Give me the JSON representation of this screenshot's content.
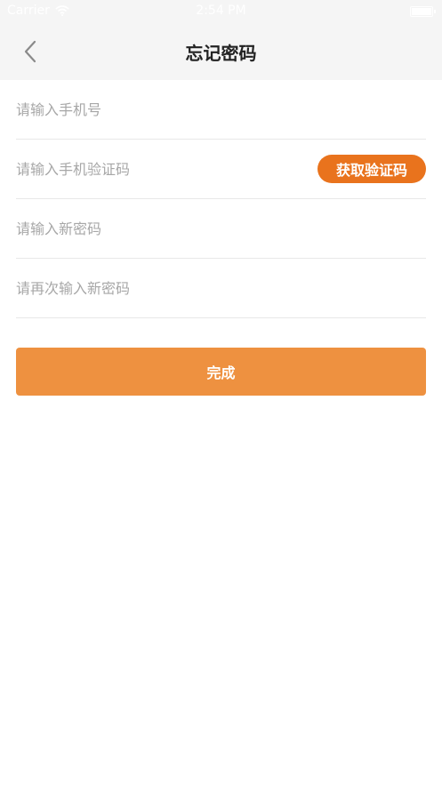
{
  "status_bar": {
    "carrier": "Carrier",
    "wifi_icon": "wifi-icon",
    "time": "2:54 PM",
    "battery_icon": "battery-icon"
  },
  "nav": {
    "back_icon": "chevron-left-icon",
    "title": "忘记密码"
  },
  "form": {
    "phone_placeholder": "请输入手机号",
    "code_placeholder": "请输入手机验证码",
    "get_code_label": "获取验证码",
    "new_password_placeholder": "请输入新密码",
    "confirm_password_placeholder": "请再次输入新密码",
    "submit_label": "完成"
  },
  "colors": {
    "accent": "#e9731d",
    "submit": "#ee9140",
    "nav_background": "#f5f5f5"
  }
}
